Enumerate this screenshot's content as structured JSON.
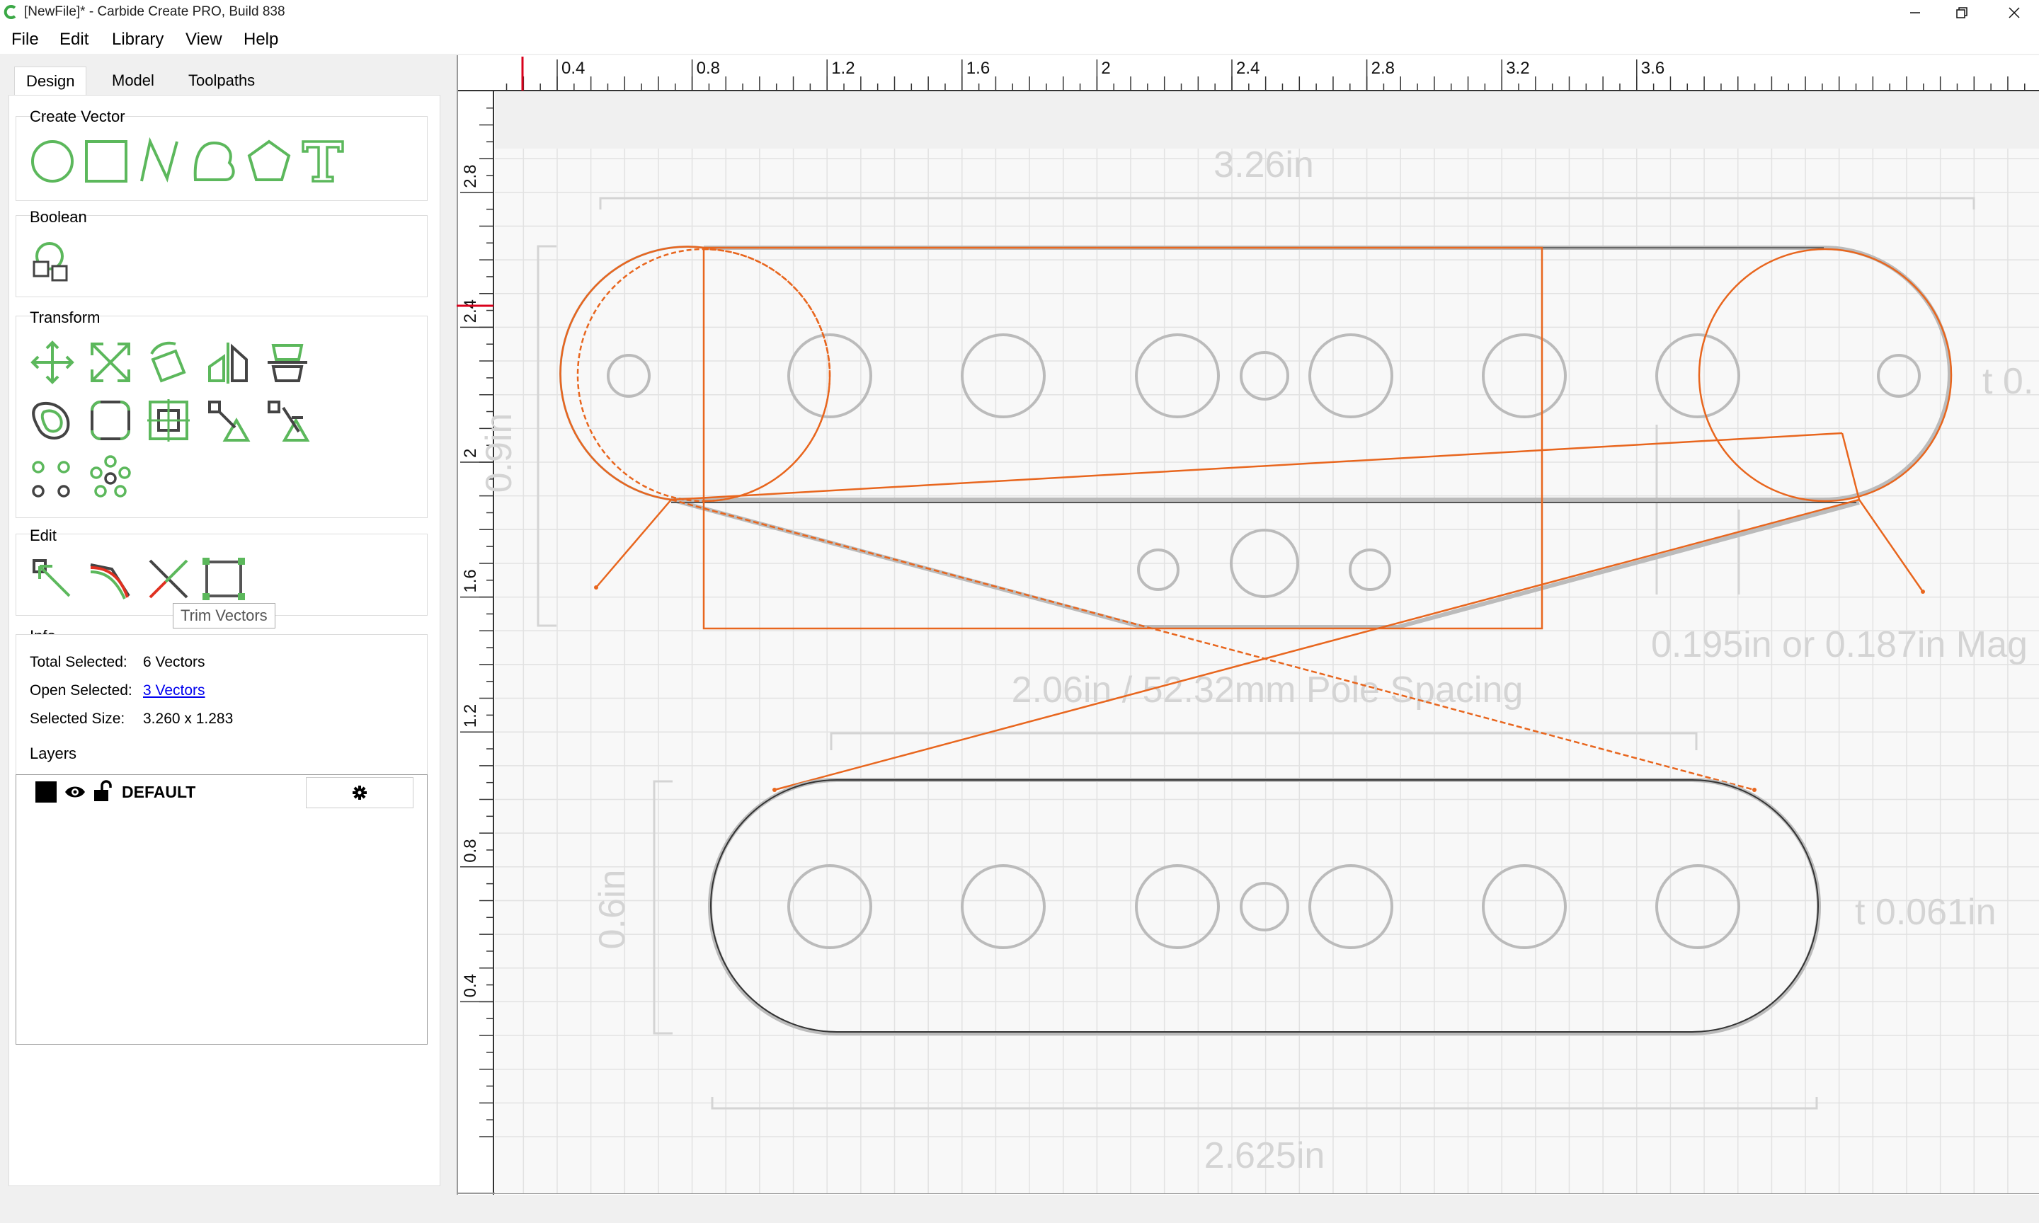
{
  "window": {
    "title": "[NewFile]* - Carbide Create PRO, Build 838"
  },
  "menu": {
    "items": [
      "File",
      "Edit",
      "Library",
      "View",
      "Help"
    ]
  },
  "tabs": [
    "Design",
    "Model",
    "Toolpaths"
  ],
  "active_tab": "Design",
  "sections": {
    "create_vector": "Create Vector",
    "boolean": "Boolean",
    "transform": "Transform",
    "edit": "Edit",
    "info": "Info",
    "layers": "Layers"
  },
  "tooltip": "Trim Vectors",
  "info": {
    "total_selected_label": "Total Selected:",
    "total_selected_value": "6 Vectors",
    "open_selected_label": "Open Selected:",
    "open_selected_value": "3 Vectors",
    "selected_size_label": "Selected Size:",
    "selected_size_value": "3.260 x 1.283"
  },
  "layers": [
    {
      "name": "DEFAULT",
      "color": "#000000"
    }
  ],
  "ruler": {
    "x_ticks": [
      "0.4",
      "0.8",
      "1.2",
      "1.6",
      "2",
      "2.4",
      "2.8",
      "3.2",
      "3.6"
    ],
    "y_ticks": [
      "2.8",
      "2.4",
      "2",
      "1.6",
      "1.2",
      "0.8",
      "0.4"
    ]
  },
  "dimensions": {
    "top_width": "3.26in",
    "left_height": "0.9in",
    "right_t": "t 0.",
    "pole_spacing": "2.06in / 52.32mm Pole Spacing",
    "magnet": "0.195in or 0.187in Mag",
    "lower_height": "0.6in",
    "lower_t": "t 0.061in",
    "bottom_width": "2.625in"
  },
  "colors": {
    "accent_green": "#5cb85c",
    "selection_orange": "#e8661e",
    "ruler_marker": "#d9001b"
  }
}
